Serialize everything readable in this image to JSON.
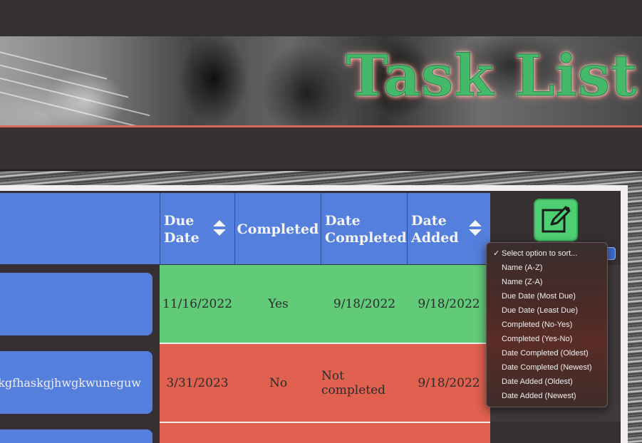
{
  "banner": {
    "title": "Task List"
  },
  "table": {
    "headers": {
      "due_date": "Due\nDate",
      "completed": "Completed",
      "date_completed": "Date\nCompleted",
      "date_added": "Date\nAdded"
    },
    "rows": [
      {
        "name": "",
        "due_date": "11/16/2022",
        "completed": "Yes",
        "date_completed": "9/18/2022",
        "date_added": "9/18/2022",
        "status_color": "#62cb7a"
      },
      {
        "name": "jgskgfhaskgjhwgkwuneguw",
        "due_date": "3/31/2023",
        "completed": "No",
        "date_completed": "Not completed",
        "date_added": "9/18/2022",
        "status_color": "#e06150"
      }
    ]
  },
  "sort_menu": {
    "selected": "Select option to sort...",
    "options": [
      "Name (A-Z)",
      "Name (Z-A)",
      "Due Date (Most Due)",
      "Due Date (Least Due)",
      "Completed (No-Yes)",
      "Completed (Yes-No)",
      "Date Completed (Oldest)",
      "Date Completed (Newest)",
      "Date Added (Oldest)",
      "Date Added (Newest)"
    ]
  },
  "icons": {
    "add_task": "pencil-square-icon",
    "sort": "sort-arrows-icon",
    "check": "check-icon"
  },
  "colors": {
    "header": "#557fdc",
    "completed_row": "#62cb7a",
    "overdue_row": "#e06150",
    "title_green": "#45b96a",
    "accent_red": "#d9695a"
  }
}
